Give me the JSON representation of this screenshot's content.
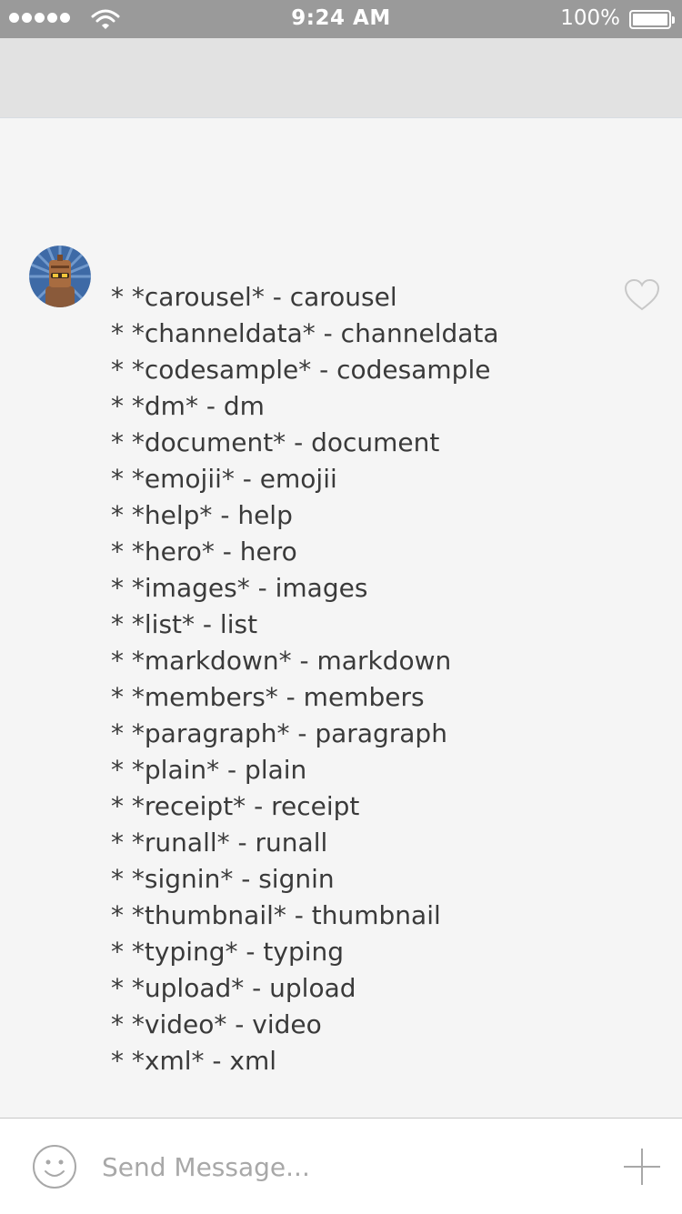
{
  "status_bar": {
    "time": "9:24 AM",
    "battery_percent": "100%",
    "signal_bars": 5,
    "icons": [
      "signal-dots-icon",
      "wifi-icon",
      "battery-icon"
    ]
  },
  "colors": {
    "status_bar_bg": "#9a9a9a",
    "header_bg": "#e2e2e2",
    "chat_bg": "#f5f5f5",
    "text": "#3a3a3a",
    "placeholder": "#a8a8a8"
  },
  "message": {
    "avatar_icon": "robot-avatar-icon",
    "like_icon": "heart-outline-icon",
    "lines": [
      "* *carousel* - carousel",
      "* *channeldata* - channeldata",
      "* *codesample* - codesample",
      "* *dm* - dm",
      "* *document* - document",
      "* *emojii* - emojii",
      "* *help* - help",
      "* *hero* - hero",
      "* *images* - images",
      "* *list* - list",
      "* *markdown* - markdown",
      "* *members* - members",
      "* *paragraph* - paragraph",
      "* *plain* - plain",
      "* *receipt* - receipt",
      "* *runall* - runall",
      "* *signin* - signin",
      "* *thumbnail* - thumbnail",
      "* *typing* - typing",
      "* *upload* - upload",
      "* *video* - video",
      "* *xml* - xml"
    ]
  },
  "composer": {
    "placeholder": "Send Message...",
    "value": "",
    "emoji_icon": "smiley-icon",
    "add_icon": "plus-icon"
  }
}
